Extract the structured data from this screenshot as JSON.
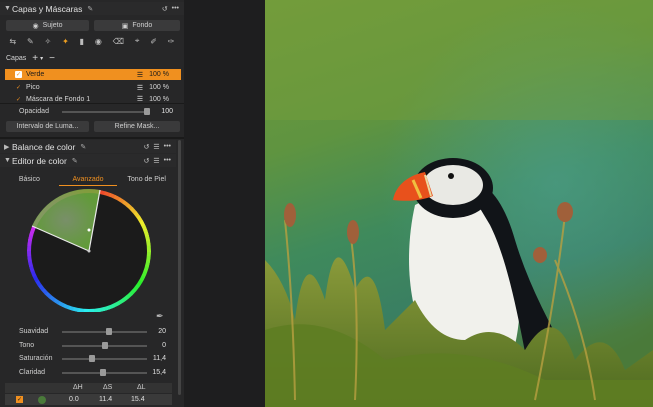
{
  "capas_mascaras": {
    "title": "Capas y Máscaras",
    "subject_btn": "Sujeto",
    "background_btn": "Fondo",
    "layers_label": "Capas",
    "layers": [
      {
        "name": "Verde",
        "value": "100 %",
        "selected": true
      },
      {
        "name": "Pico",
        "value": "100 %",
        "selected": false
      },
      {
        "name": "Máscara de Fondo 1",
        "value": "100 %",
        "selected": false
      }
    ],
    "opacity_label": "Opacidad",
    "opacity_value": "100",
    "opacity_level": 1.0,
    "luma_btn": "Intervalo de Luma...",
    "refine_btn": "Refine Mask..."
  },
  "balance_color": {
    "title": "Balance de color"
  },
  "editor_color": {
    "title": "Editor de color",
    "tabs": [
      "Básico",
      "Avanzado",
      "Tono de Piel"
    ],
    "active_tab": "Avanzado",
    "sliders": [
      {
        "label": "Suavidad",
        "value": "20",
        "level": 0.55
      },
      {
        "label": "Tono",
        "value": "0",
        "level": 0.5
      },
      {
        "label": "Saturación",
        "value": "11,4",
        "level": 0.35
      },
      {
        "label": "Claridad",
        "value": "15,4",
        "level": 0.48
      }
    ],
    "table": {
      "headers": [
        "ΔH",
        "ΔS",
        "ΔL"
      ],
      "row": {
        "dh": "0.0",
        "ds": "11.4",
        "dl": "15.4",
        "swatch": "#4a7a3a"
      }
    }
  },
  "colors": {
    "accent": "#f09020",
    "panel": "#272728"
  },
  "icons": [
    "pen-icon",
    "reset-icon",
    "menu-icon",
    "more-icon",
    "eyedropper-icon"
  ]
}
